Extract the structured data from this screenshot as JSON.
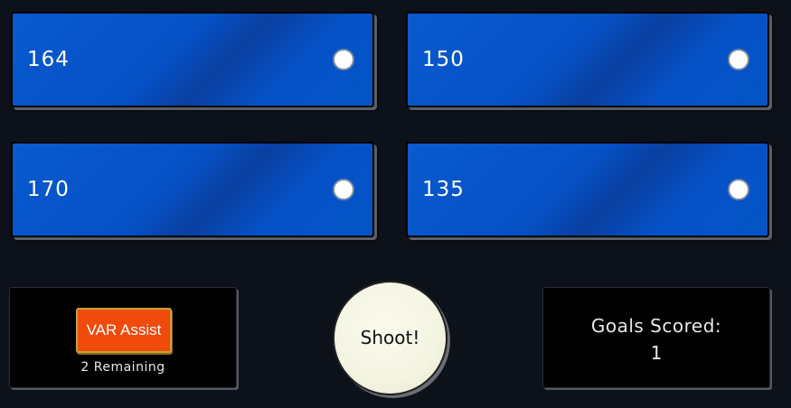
{
  "answers": [
    {
      "label": "164"
    },
    {
      "label": "150"
    },
    {
      "label": "170"
    },
    {
      "label": "135"
    }
  ],
  "var_assist": {
    "button_label": "VAR Assist",
    "remaining": "2 Remaining"
  },
  "shoot": {
    "label": "Shoot!"
  },
  "score": {
    "title": "Goals Scored:",
    "value": "1"
  },
  "colors": {
    "background": "#0d111a",
    "answer_blue": "#0550c4",
    "var_orange": "#f04a0c",
    "shoot_cream": "#f4f4e2"
  }
}
